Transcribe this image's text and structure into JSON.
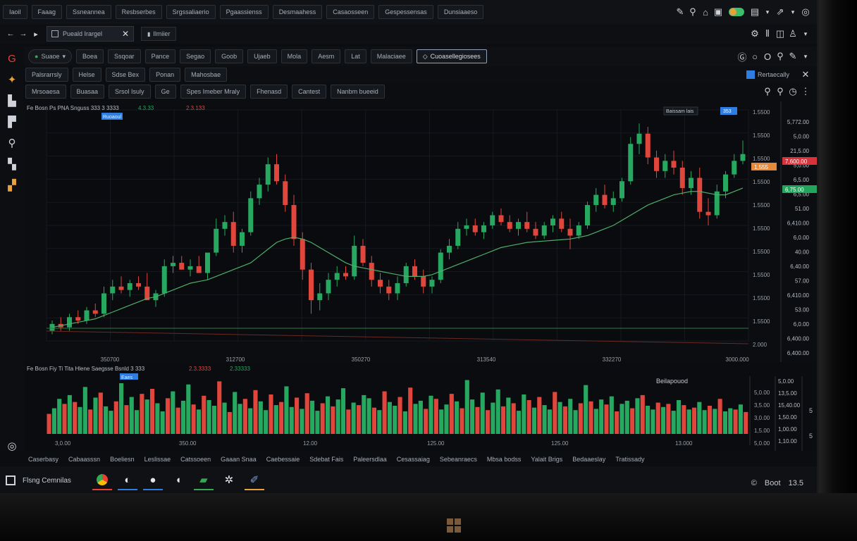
{
  "top_menu": {
    "items": [
      "Iaoil",
      "Faaag",
      "Ssneannea",
      "Resbserbes",
      "Srgssaliaerio",
      "Pgaassienss",
      "Desmaahess",
      "Casaosseen",
      "Gespessensas",
      "Dunsiaaeso"
    ],
    "icons": [
      "pencil-icon",
      "search-icon",
      "home-icon",
      "calendar-icon",
      "toggle-icon",
      "display-icon",
      "share-icon",
      "profile-icon"
    ]
  },
  "tab_bar": {
    "active_tab": "Pueald Irargel",
    "second_tab": "Ilmiier",
    "icons": [
      "settings-icon",
      "bars-icon",
      "chat-icon",
      "user-icon"
    ]
  },
  "toolbar": {
    "symbol": "Suaoe",
    "buttons": [
      "Boea",
      "Ssqoar",
      "Pance",
      "Segao",
      "Goob",
      "Ujaeb",
      "Mola",
      "Aesm",
      "Lat",
      "Malaciaee"
    ],
    "selected": "Cuoasellegiosees",
    "right_icons": [
      "google-icon",
      "circle-icon",
      "ring-icon",
      "pin-icon",
      "pen-icon"
    ]
  },
  "subbar": {
    "items": [
      "Palsrarrsly",
      "Helse",
      "Sdse Bex",
      "Ponan",
      "Mahosbae"
    ],
    "search_label": "Rertaecally"
  },
  "indicator_bar": {
    "items": [
      "Mrsoaesa",
      "Buasaa",
      "Srsol Isuly",
      "Ge",
      "Spes Imeber Mraly",
      "Fhenasd",
      "Cantest",
      "Nanbm bueeid"
    ]
  },
  "main_chart": {
    "legend_line": "Fe Bosn Ps PNA Snguss 333 3 3333",
    "legend_val1": "4.3.33",
    "legend_val2": "2.3.133",
    "badge_label": "Ruoaoul",
    "top_right_label": "Baissam lais",
    "top_right_value": "353",
    "x_labels": [
      "350700",
      "312700",
      "350270",
      "313540",
      "332270",
      "3000.000"
    ],
    "price_scale": [
      "1.5500",
      "1.5500",
      "1.5500",
      "1.5500",
      "1.5500",
      "1.5500",
      "1.5500",
      "1.5500",
      "1.5500",
      "1.5500",
      "2.000"
    ],
    "outer_scale": [
      "5,772.00",
      "5,0.00",
      "21,5.00",
      "5,0.00",
      "6,5.00",
      "6,5.00",
      "51.00",
      "6,410.00",
      "6,0.00",
      "40.00",
      "6,40.00",
      "57.00",
      "6,410.00",
      "53.00",
      "6,0.00",
      "6,400.00",
      "6,400.00"
    ],
    "red_tag": "7,600.00",
    "green_tag": "6,75.00",
    "orange_tag": "1,555"
  },
  "volume_chart": {
    "legend_line": "Fe Bosn Fiy Ti Tita Hlene Saegsse Bsnld 3 333",
    "legend_val1": "2.3.3333",
    "legend_val2": "2.33333",
    "badge_label": "Eaes",
    "title": "Beilapouod",
    "x_labels": [
      "3,0.00",
      "350.00",
      "12.00",
      "125.00",
      "125.00",
      "13.000"
    ],
    "price_scale": [
      "5,0.00",
      "3,5.00",
      "3,0.00",
      "1,5.00",
      "5,0.00"
    ],
    "outer_scale": [
      "5,0.00",
      "13,5.00",
      "15,40.00",
      "1,50.00",
      "1,00.00",
      "1,10.00"
    ],
    "side_marks": [
      "5",
      "5"
    ]
  },
  "status_bar": {
    "items": [
      "Caserbasy",
      "Cabaasssn",
      "Boeliesn",
      "Leslissae",
      "Catssoeen",
      "Gaaan Snaa",
      "Caebessaie",
      "Sdebat Fais",
      "Paleersdlaa",
      "Cesassaiag",
      "Sebeanraecs",
      "Mbsa bodss",
      "Yalait Brigs",
      "Bedaaeslay",
      "Tratissady"
    ]
  },
  "taskbar": {
    "start_label": "Flsng Cemnilas",
    "apps": [
      "chrome-icon",
      "edge-icon",
      "globe-icon",
      "shield-icon",
      "terminal-icon",
      "settings-icon",
      "pen-icon"
    ],
    "tray_label": "Boot",
    "time": "13.5"
  },
  "chart_data": {
    "type": "line",
    "title": "",
    "candles": [
      [
        4.1,
        4.4,
        4.0,
        4.3
      ],
      [
        4.3,
        4.5,
        4.1,
        4.2
      ],
      [
        4.2,
        4.6,
        4.1,
        4.5
      ],
      [
        4.5,
        4.7,
        4.3,
        4.4
      ],
      [
        4.4,
        4.8,
        4.3,
        4.7
      ],
      [
        4.7,
        4.9,
        4.5,
        4.6
      ],
      [
        4.6,
        5.4,
        4.5,
        5.2
      ],
      [
        5.2,
        5.6,
        5.0,
        5.4
      ],
      [
        5.4,
        5.7,
        5.2,
        5.3
      ],
      [
        5.3,
        5.6,
        5.1,
        5.5
      ],
      [
        5.5,
        5.7,
        5.3,
        5.4
      ],
      [
        5.4,
        5.8,
        5.2,
        5.0
      ],
      [
        5.0,
        5.3,
        4.8,
        5.2
      ],
      [
        5.2,
        6.2,
        5.1,
        6.0
      ],
      [
        6.0,
        6.3,
        5.8,
        6.1
      ],
      [
        6.1,
        6.3,
        5.9,
        5.9
      ],
      [
        5.9,
        6.2,
        5.7,
        6.0
      ],
      [
        6.0,
        6.3,
        5.8,
        5.8
      ],
      [
        5.8,
        6.3,
        5.6,
        6.4
      ],
      [
        6.4,
        7.4,
        6.3,
        7.1
      ],
      [
        7.1,
        7.5,
        6.9,
        7.3
      ],
      [
        7.3,
        7.6,
        6.4,
        6.6
      ],
      [
        6.6,
        7.1,
        6.4,
        7.0
      ],
      [
        7.0,
        8.2,
        6.9,
        8.0
      ],
      [
        8.0,
        8.6,
        7.8,
        8.4
      ],
      [
        8.4,
        9.2,
        8.2,
        9.0
      ],
      [
        9.0,
        9.3,
        8.4,
        8.5
      ],
      [
        8.5,
        8.7,
        7.6,
        7.8
      ],
      [
        7.8,
        8.1,
        6.6,
        6.8
      ],
      [
        6.8,
        7.0,
        5.6,
        5.9
      ],
      [
        5.9,
        6.1,
        4.6,
        5.0
      ],
      [
        5.0,
        5.5,
        4.7,
        5.2
      ],
      [
        5.2,
        5.8,
        5.0,
        5.6
      ],
      [
        5.6,
        6.0,
        5.4,
        5.8
      ],
      [
        5.8,
        6.0,
        5.6,
        5.7
      ],
      [
        5.7,
        6.9,
        5.6,
        6.6
      ],
      [
        6.6,
        6.8,
        6.0,
        6.1
      ],
      [
        6.1,
        6.3,
        5.4,
        5.6
      ],
      [
        5.6,
        5.8,
        5.2,
        5.4
      ],
      [
        5.4,
        5.6,
        5.0,
        5.2
      ],
      [
        5.2,
        5.7,
        5.0,
        5.5
      ],
      [
        5.5,
        6.1,
        5.4,
        6.0
      ],
      [
        6.0,
        6.2,
        5.6,
        5.7
      ],
      [
        5.7,
        5.9,
        5.2,
        5.4
      ],
      [
        5.4,
        5.7,
        5.2,
        5.6
      ],
      [
        5.6,
        6.5,
        5.5,
        6.4
      ],
      [
        6.4,
        6.8,
        6.2,
        6.6
      ],
      [
        6.6,
        7.3,
        6.5,
        7.1
      ],
      [
        7.1,
        7.4,
        6.9,
        7.2
      ],
      [
        7.2,
        7.4,
        6.9,
        7.0
      ],
      [
        7.0,
        7.3,
        6.8,
        7.2
      ],
      [
        7.2,
        7.6,
        7.1,
        7.5
      ],
      [
        7.5,
        7.7,
        7.2,
        7.3
      ],
      [
        7.3,
        7.5,
        7.0,
        7.1
      ],
      [
        7.1,
        7.4,
        6.9,
        7.3
      ],
      [
        7.3,
        7.6,
        7.0,
        7.1
      ],
      [
        7.1,
        7.3,
        6.8,
        6.9
      ],
      [
        6.9,
        7.3,
        6.8,
        7.2
      ],
      [
        7.2,
        7.5,
        7.0,
        7.4
      ],
      [
        7.4,
        7.6,
        7.0,
        7.1
      ],
      [
        7.1,
        7.4,
        6.5,
        6.9
      ],
      [
        6.9,
        7.3,
        6.8,
        7.2
      ],
      [
        7.2,
        7.9,
        7.1,
        7.8
      ],
      [
        7.8,
        8.3,
        7.6,
        8.1
      ],
      [
        8.1,
        8.4,
        7.7,
        7.8
      ],
      [
        7.8,
        8.2,
        7.6,
        8.0
      ],
      [
        8.0,
        8.6,
        7.9,
        8.5
      ],
      [
        8.5,
        9.8,
        8.4,
        9.6
      ],
      [
        9.6,
        10.2,
        9.3,
        9.9
      ],
      [
        9.9,
        10.1,
        9.0,
        9.2
      ],
      [
        9.2,
        9.4,
        8.6,
        8.8
      ],
      [
        8.8,
        9.3,
        8.6,
        9.1
      ],
      [
        9.1,
        9.4,
        8.7,
        8.9
      ],
      [
        8.9,
        9.1,
        8.1,
        8.3
      ],
      [
        8.3,
        8.8,
        8.1,
        8.6
      ],
      [
        8.6,
        8.9,
        7.4,
        7.6
      ],
      [
        7.6,
        8.0,
        7.2,
        7.5
      ],
      [
        7.5,
        8.4,
        7.4,
        8.2
      ],
      [
        8.2,
        8.8,
        8.0,
        8.7
      ],
      [
        8.7,
        9.3,
        8.6,
        9.1
      ],
      [
        9.1,
        9.7,
        9.0,
        9.3
      ]
    ],
    "ma": [
      4.2,
      4.25,
      4.3,
      4.35,
      4.4,
      4.45,
      4.55,
      4.65,
      4.75,
      4.85,
      4.95,
      5.05,
      5.1,
      5.2,
      5.3,
      5.4,
      5.5,
      5.55,
      5.6,
      5.7,
      5.8,
      5.9,
      6.0,
      6.1,
      6.3,
      6.5,
      6.7,
      6.8,
      6.85,
      6.8,
      6.7,
      6.55,
      6.4,
      6.25,
      6.1,
      6.0,
      5.95,
      5.9,
      5.85,
      5.8,
      5.75,
      5.7,
      5.7,
      5.7,
      5.75,
      5.85,
      5.95,
      6.05,
      6.15,
      6.25,
      6.35,
      6.45,
      6.55,
      6.6,
      6.65,
      6.7,
      6.72,
      6.74,
      6.76,
      6.78,
      6.8,
      6.85,
      6.9,
      7.0,
      7.1,
      7.2,
      7.35,
      7.5,
      7.65,
      7.8,
      7.9,
      8.0,
      8.1,
      8.15,
      8.2,
      8.2,
      8.15,
      8.1,
      8.1,
      8.2,
      8.3
    ],
    "ylim": [
      3.8,
      10.6
    ],
    "volume": [
      3.2,
      4.1,
      5.6,
      4.8,
      6.2,
      5.1,
      4.3,
      7.5,
      3.9,
      5.8,
      6.6,
      4.4,
      3.7,
      5.2,
      8.1,
      4.6,
      5.9,
      3.8,
      6.4,
      5.5,
      7.2,
      4.9,
      3.6,
      5.7,
      6.8,
      4.2,
      5.3,
      7.9,
      4.7,
      3.9,
      6.1,
      5.4,
      4.5,
      8.4,
      5.0,
      3.5,
      6.7,
      4.8,
      5.6,
      4.1,
      7.0,
      5.2,
      3.8,
      6.3,
      4.6,
      5.1,
      7.6,
      4.3,
      5.8,
      4.0,
      6.5,
      5.3,
      3.7,
      4.9,
      6.0,
      4.4,
      5.5,
      7.3,
      3.9,
      5.0,
      4.6,
      6.2,
      5.7,
      4.2,
      3.8,
      6.8,
      5.1,
      4.5,
      5.9,
      3.6,
      7.4,
      4.8,
      5.3,
      4.0,
      6.1,
      5.6,
      3.9,
      4.7,
      6.4,
      5.2,
      4.1,
      8.6,
      5.5,
      4.3,
      6.6,
      3.8,
      5.0,
      7.1,
      4.4,
      5.8,
      4.9,
      3.7,
      6.3,
      5.4,
      4.2,
      5.9,
      4.6,
      3.9,
      6.7,
      5.1,
      4.4,
      5.6,
      3.8,
      4.9,
      7.8,
      5.2,
      4.0,
      5.5,
      4.7,
      6.0,
      3.6,
      4.8,
      5.3,
      4.1,
      5.7,
      6.2,
      4.5,
      3.9,
      5.0,
      4.3,
      4.8,
      3.7,
      5.4,
      4.6,
      3.9,
      4.2,
      5.1,
      3.8,
      4.5,
      4.0,
      5.6,
      3.6,
      4.1,
      3.9,
      4.7,
      3.5
    ]
  },
  "colors": {
    "up": "#27a860",
    "down": "#e0463c",
    "ma": "#4fae6a",
    "bg": "#0b0d10",
    "grid": "#161a20"
  }
}
